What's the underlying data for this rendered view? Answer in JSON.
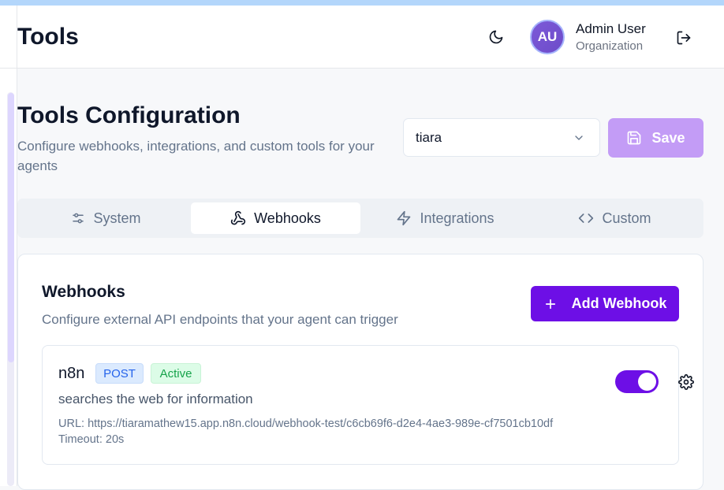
{
  "header": {
    "title": "Tools",
    "user_initials": "AU",
    "user_name": "Admin User",
    "user_org": "Organization"
  },
  "page": {
    "title": "Tools Configuration",
    "subtitle": "Configure webhooks, integrations, and custom tools for your agents",
    "agent_select_value": "tiara",
    "save_label": "Save"
  },
  "tabs": [
    {
      "label": "System",
      "icon": "sliders-icon"
    },
    {
      "label": "Webhooks",
      "icon": "webhook-icon",
      "active": true
    },
    {
      "label": "Integrations",
      "icon": "zap-icon"
    },
    {
      "label": "Custom",
      "icon": "code-icon"
    }
  ],
  "webhooks_section": {
    "title": "Webhooks",
    "subtitle": "Configure external API endpoints that your agent can trigger",
    "add_label": "Add Webhook",
    "items": [
      {
        "name": "n8n",
        "method": "POST",
        "status": "Active",
        "description": "searches the web for information",
        "url": "URL: https://tiaramathew15.app.n8n.cloud/webhook-test/c6cb69f6-d2e4-4ae3-989e-cf7501cb10df",
        "timeout": "Timeout: 20s",
        "enabled": true
      }
    ]
  },
  "colors": {
    "accent": "#6d0fe6",
    "save_disabled": "#c39cf6"
  }
}
